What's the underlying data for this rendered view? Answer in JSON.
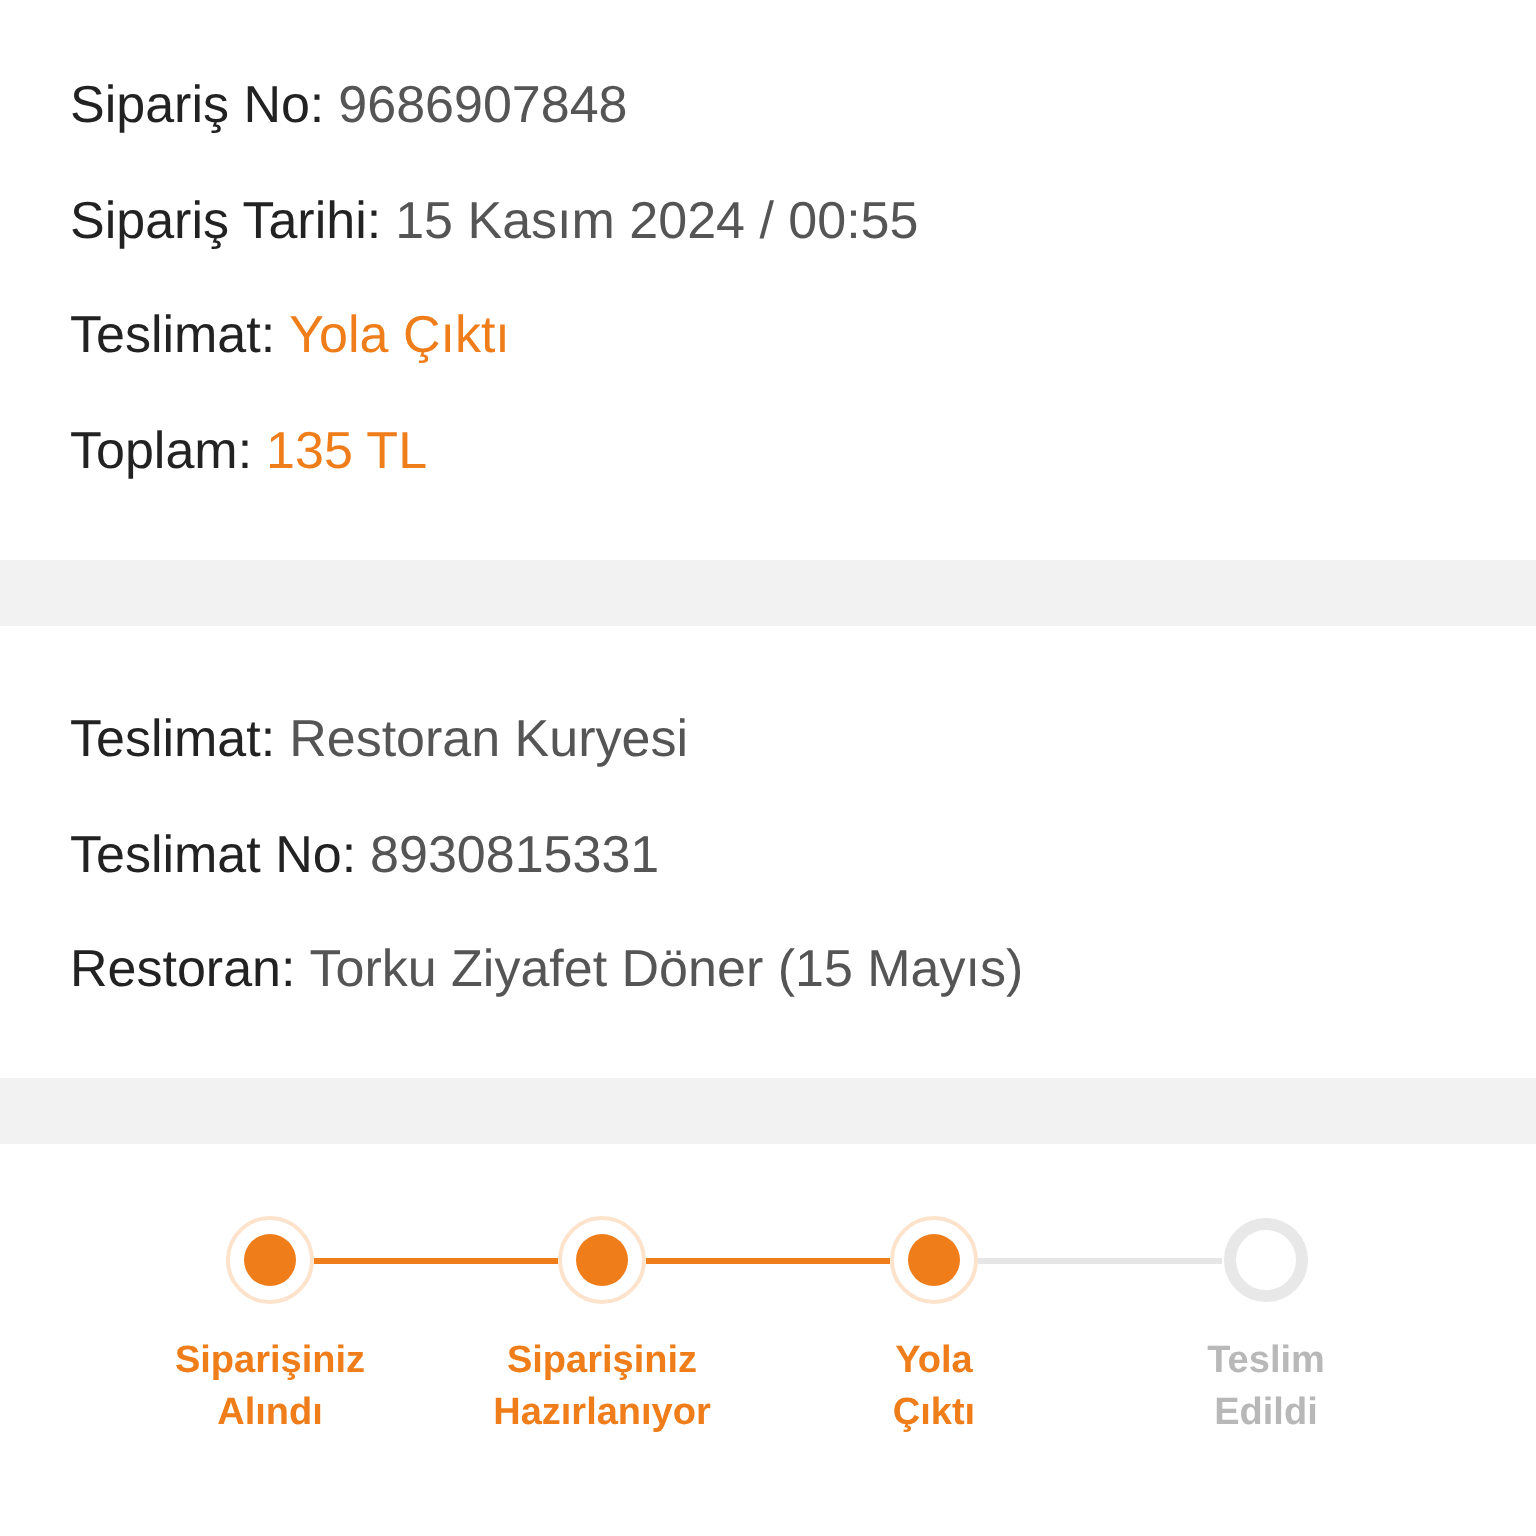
{
  "order": [
    {
      "label": "Sipariş No:",
      "value": "9686907848",
      "kind": "plain"
    },
    {
      "label": "Sipariş Tarihi:",
      "value": "15 Kasım 2024 / 00:55",
      "kind": "plain"
    },
    {
      "label": "Teslimat:",
      "value": "Yola Çıktı",
      "kind": "accent"
    },
    {
      "label": "Toplam:",
      "value": "135 TL",
      "kind": "accent"
    }
  ],
  "delivery": [
    {
      "label": "Teslimat:",
      "value": "Restoran Kuryesi"
    },
    {
      "label": "Teslimat No:",
      "value": "8930815331"
    },
    {
      "label": "Restoran:",
      "value": "Torku Ziyafet Döner (15 Mayıs)"
    }
  ],
  "steps": [
    {
      "lines": [
        "Siparişiniz",
        "Alındı"
      ],
      "completed": true
    },
    {
      "lines": [
        "Siparişiniz",
        "Hazırlanıyor"
      ],
      "completed": true
    },
    {
      "lines": [
        "Yola",
        "Çıktı"
      ],
      "completed": true
    },
    {
      "lines": [
        "Teslim",
        "Edildi"
      ],
      "completed": false
    }
  ]
}
